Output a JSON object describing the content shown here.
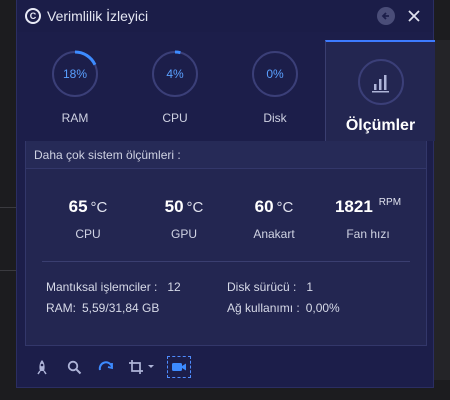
{
  "window": {
    "title": "Verimlilik İzleyici"
  },
  "tabs": [
    {
      "label": "RAM",
      "value": "18%",
      "percent": 18
    },
    {
      "label": "CPU",
      "value": "4%",
      "percent": 4
    },
    {
      "label": "Disk",
      "value": "0%",
      "percent": 0
    },
    {
      "label": "Ölçümler"
    }
  ],
  "panel": {
    "header": "Daha çok sistem ölçümleri :",
    "metrics": [
      {
        "value": "65",
        "unit": "°C",
        "label": "CPU"
      },
      {
        "value": "50",
        "unit": "°C",
        "label": "GPU"
      },
      {
        "value": "60",
        "unit": "°C",
        "label": "Anakart"
      },
      {
        "value": "1821",
        "unit": "RPM",
        "label": "Fan hızı"
      }
    ],
    "info": {
      "logical_processors_label": "Mantıksal işlemciler :",
      "logical_processors_value": "12",
      "ram_label": "RAM:",
      "ram_value": "5,59/31,84 GB",
      "disk_drives_label": "Disk sürücü :",
      "disk_drives_value": "1",
      "network_label": "Ağ kullanımı :",
      "network_value": "0,00%"
    }
  },
  "toolbar": {
    "icons": [
      "rocket-icon",
      "search-icon",
      "refresh-icon",
      "crop-icon",
      "video-record-icon"
    ]
  },
  "colors": {
    "accent": "#3d7bff",
    "ring_track": "#3b3f78",
    "ring_fill": "#3d8bff",
    "background": "#1c1e4a"
  }
}
